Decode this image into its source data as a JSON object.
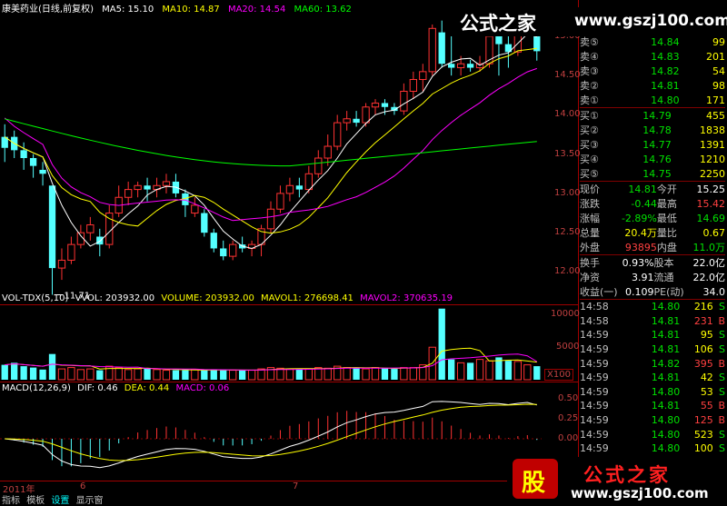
{
  "watermark": {
    "title": "公式之家",
    "url": "www.gszj100.com",
    "bottom_logo": "股",
    "bottom_title": "公式之家",
    "bottom_url": "www.gszj100.com"
  },
  "main_header": {
    "name": "康美药业(日线,前复权)",
    "ma5": "MA5: 15.10",
    "ma10": "MA10: 14.87",
    "ma20": "MA20: 14.54",
    "ma60": "MA60: 13.62"
  },
  "price_axis": [
    "15.00",
    "14.50",
    "14.00",
    "13.50",
    "13.00",
    "12.50",
    "12.00"
  ],
  "low_label": "11.71",
  "vol_header": {
    "name": "VOL-TDX(5,10)",
    "vvol": "VVOL: 203932.00",
    "volume": "VOLUME: 203932.00",
    "mavol1": "MAVOL1: 276698.41",
    "mavol2": "MAVOL2: 370635.19"
  },
  "vol_axis": [
    "10000",
    "5000"
  ],
  "vol_unit": "X100",
  "macd_header": {
    "name": "MACD(12,26,9)",
    "dif": "DIF: 0.46",
    "dea": "DEA: 0.44",
    "macd": "MACD: 0.06"
  },
  "macd_axis": [
    "0.50",
    "0.25",
    "0.00"
  ],
  "date_axis": {
    "year": "2011年",
    "m1": "6",
    "m2": "7"
  },
  "bottom_tabs": [
    "指标",
    "模板",
    "设置",
    "显示窗"
  ],
  "quote": {
    "asks": [
      {
        "label": "卖⑤",
        "price": "14.84",
        "vol": "99"
      },
      {
        "label": "卖④",
        "price": "14.83",
        "vol": "201"
      },
      {
        "label": "卖③",
        "price": "14.82",
        "vol": "54"
      },
      {
        "label": "卖②",
        "price": "14.81",
        "vol": "98"
      },
      {
        "label": "卖①",
        "price": "14.80",
        "vol": "171"
      }
    ],
    "bids": [
      {
        "label": "买①",
        "price": "14.79",
        "vol": "455"
      },
      {
        "label": "买②",
        "price": "14.78",
        "vol": "1838"
      },
      {
        "label": "买③",
        "price": "14.77",
        "vol": "1391"
      },
      {
        "label": "买④",
        "price": "14.76",
        "vol": "1210"
      },
      {
        "label": "买⑤",
        "price": "14.75",
        "vol": "2250"
      }
    ],
    "stats": [
      {
        "l1": "现价",
        "v1": "14.81",
        "l2": "今开",
        "v2": "15.25",
        "c1": "#00e000",
        "c2": "#ffffff"
      },
      {
        "l1": "涨跌",
        "v1": "-0.44",
        "l2": "最高",
        "v2": "15.42",
        "c1": "#00e000",
        "c2": "#ff4040"
      },
      {
        "l1": "涨幅",
        "v1": "-2.89%",
        "l2": "最低",
        "v2": "14.69",
        "c1": "#00e000",
        "c2": "#00e000"
      },
      {
        "l1": "总量",
        "v1": "20.4万",
        "l2": "量比",
        "v2": "0.67",
        "c1": "#ffff00",
        "c2": "#ffff00"
      },
      {
        "l1": "外盘",
        "v1": "93895",
        "l2": "内盘",
        "v2": "11.0万",
        "c1": "#ff4040",
        "c2": "#00e000"
      }
    ],
    "stats2": [
      {
        "l1": "换手",
        "v1": "0.93%",
        "l2": "股本",
        "v2": "22.0亿"
      },
      {
        "l1": "净资",
        "v1": "3.91",
        "l2": "流通",
        "v2": "22.0亿"
      },
      {
        "l1": "收益(一)",
        "v1": "0.109",
        "l2": "PE(动)",
        "v2": "34.0"
      }
    ]
  },
  "ticks": [
    {
      "time": "14:58",
      "price": "14.80",
      "vol": "216",
      "dir": "S"
    },
    {
      "time": "14:58",
      "price": "14.81",
      "vol": "231",
      "dir": "B"
    },
    {
      "time": "14:59",
      "price": "14.81",
      "vol": "95",
      "dir": "S"
    },
    {
      "time": "14:59",
      "price": "14.81",
      "vol": "106",
      "dir": "S"
    },
    {
      "time": "14:59",
      "price": "14.82",
      "vol": "395",
      "dir": "B"
    },
    {
      "time": "14:59",
      "price": "14.81",
      "vol": "42",
      "dir": "S"
    },
    {
      "time": "14:59",
      "price": "14.80",
      "vol": "53",
      "dir": "S"
    },
    {
      "time": "14:59",
      "price": "14.81",
      "vol": "55",
      "dir": "B"
    },
    {
      "time": "14:59",
      "price": "14.80",
      "vol": "125",
      "dir": "B"
    },
    {
      "time": "14:59",
      "price": "14.80",
      "vol": "523",
      "dir": "S"
    },
    {
      "time": "14:59",
      "price": "14.80",
      "vol": "100",
      "dir": "S"
    }
  ],
  "candles": [
    [
      13.58,
      13.72,
      13.4,
      13.88,
      "d"
    ],
    [
      13.72,
      13.55,
      13.45,
      13.8,
      "d"
    ],
    [
      13.55,
      13.45,
      13.3,
      13.65,
      "d"
    ],
    [
      13.45,
      13.35,
      13.2,
      13.5,
      "d"
    ],
    [
      13.3,
      13.25,
      13.1,
      13.4,
      "d"
    ],
    [
      13.1,
      12.05,
      11.71,
      13.1,
      "d"
    ],
    [
      12.05,
      12.15,
      11.9,
      12.3,
      "u"
    ],
    [
      12.15,
      12.35,
      12.1,
      12.45,
      "u"
    ],
    [
      12.35,
      12.5,
      12.3,
      12.6,
      "u"
    ],
    [
      12.5,
      12.6,
      12.4,
      12.7,
      "u"
    ],
    [
      12.45,
      12.35,
      12.2,
      12.55,
      "d"
    ],
    [
      12.35,
      12.75,
      12.3,
      12.85,
      "u"
    ],
    [
      12.75,
      12.95,
      12.7,
      13.1,
      "u"
    ],
    [
      12.95,
      13.05,
      12.85,
      13.15,
      "u"
    ],
    [
      13.05,
      13.1,
      12.95,
      13.15,
      "u"
    ],
    [
      13.1,
      13.05,
      12.9,
      13.2,
      "d"
    ],
    [
      13.05,
      13.1,
      12.95,
      13.2,
      "u"
    ],
    [
      13.1,
      13.15,
      13.0,
      13.25,
      "u"
    ],
    [
      13.15,
      13.0,
      12.95,
      13.25,
      "d"
    ],
    [
      13.0,
      12.85,
      12.7,
      13.05,
      "d"
    ],
    [
      12.85,
      12.75,
      12.7,
      12.95,
      "u"
    ],
    [
      12.75,
      12.5,
      12.45,
      12.8,
      "d"
    ],
    [
      12.5,
      12.3,
      12.25,
      12.55,
      "d"
    ],
    [
      12.3,
      12.2,
      12.15,
      12.4,
      "d"
    ],
    [
      12.2,
      12.35,
      12.15,
      12.4,
      "u"
    ],
    [
      12.35,
      12.3,
      12.25,
      12.45,
      "d"
    ],
    [
      12.3,
      12.35,
      12.2,
      12.4,
      "u"
    ],
    [
      12.35,
      12.55,
      12.2,
      12.6,
      "u"
    ],
    [
      12.55,
      12.8,
      12.5,
      12.9,
      "u"
    ],
    [
      12.8,
      13.0,
      12.75,
      13.1,
      "u"
    ],
    [
      13.0,
      13.1,
      12.9,
      13.2,
      "u"
    ],
    [
      13.1,
      13.05,
      12.95,
      13.2,
      "d"
    ],
    [
      13.05,
      13.25,
      13.0,
      13.35,
      "u"
    ],
    [
      13.25,
      13.45,
      13.2,
      13.55,
      "u"
    ],
    [
      13.45,
      13.6,
      13.35,
      13.75,
      "u"
    ],
    [
      13.6,
      13.9,
      13.55,
      14.0,
      "u"
    ],
    [
      13.9,
      13.95,
      13.8,
      14.05,
      "u"
    ],
    [
      13.95,
      13.9,
      13.85,
      14.05,
      "d"
    ],
    [
      13.9,
      14.1,
      13.85,
      14.15,
      "u"
    ],
    [
      14.1,
      14.15,
      14.0,
      14.2,
      "u"
    ],
    [
      14.15,
      14.1,
      14.0,
      14.2,
      "d"
    ],
    [
      14.1,
      14.05,
      14.0,
      14.15,
      "d"
    ],
    [
      14.05,
      14.3,
      14.0,
      14.4,
      "u"
    ],
    [
      14.3,
      14.45,
      14.2,
      14.55,
      "u"
    ],
    [
      14.45,
      14.55,
      14.3,
      14.65,
      "u"
    ],
    [
      14.55,
      15.1,
      14.5,
      15.15,
      "u"
    ],
    [
      15.05,
      14.65,
      14.6,
      15.2,
      "d"
    ],
    [
      14.65,
      14.6,
      14.5,
      15.5,
      "d"
    ],
    [
      14.6,
      14.65,
      14.5,
      14.75,
      "u"
    ],
    [
      14.65,
      14.6,
      14.55,
      14.7,
      "d"
    ],
    [
      14.6,
      14.65,
      14.55,
      14.75,
      "u"
    ],
    [
      14.65,
      15.0,
      14.6,
      15.1,
      "u"
    ],
    [
      15.0,
      14.9,
      14.5,
      15.05,
      "d"
    ],
    [
      14.9,
      14.8,
      14.6,
      15.25,
      "d"
    ],
    [
      14.8,
      15.2,
      14.75,
      15.3,
      "u"
    ],
    [
      15.2,
      15.25,
      15.1,
      15.35,
      "u"
    ],
    [
      15.25,
      14.81,
      14.69,
      15.42,
      "d"
    ]
  ],
  "volumes": [
    22,
    25,
    20,
    18,
    15,
    38,
    16,
    18,
    15,
    16,
    14,
    20,
    18,
    15,
    16,
    17,
    15,
    14,
    14,
    14,
    15,
    14,
    15,
    14,
    14,
    14,
    14,
    16,
    18,
    17,
    16,
    15,
    16,
    18,
    17,
    20,
    18,
    17,
    16,
    18,
    17,
    16,
    18,
    18,
    22,
    48,
    105,
    30,
    25,
    25,
    30,
    28,
    33,
    28,
    27,
    22,
    20
  ]
}
